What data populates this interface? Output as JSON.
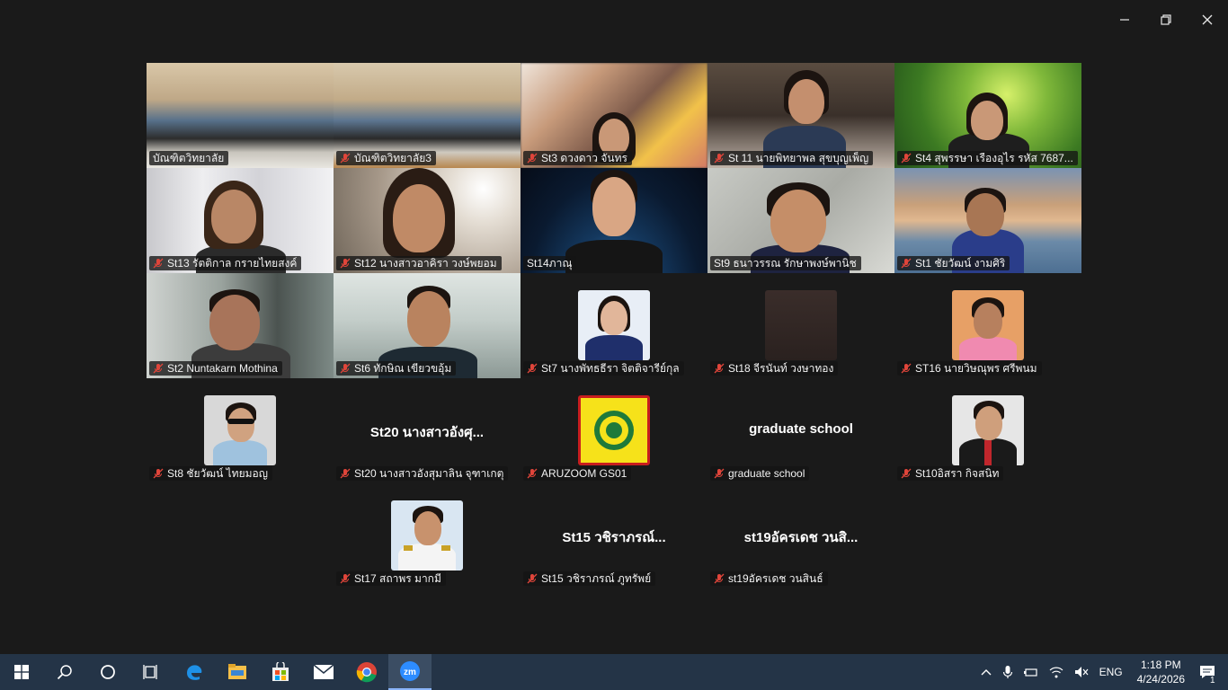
{
  "window": {
    "minimize_icon": "minimize-icon",
    "restore_icon": "restore-icon",
    "close_icon": "close-icon"
  },
  "participants": [
    {
      "name": "บัณฑิตวิทยาลัย",
      "muted": false,
      "type": "video"
    },
    {
      "name": "บัณฑิตวิทยาลัย3",
      "muted": true,
      "type": "video"
    },
    {
      "name": "St3 ดวงดาว จันทร",
      "muted": true,
      "type": "video"
    },
    {
      "name": "St 11 นายพิทยาพล สุขบุญเพ็ญ",
      "muted": true,
      "type": "video"
    },
    {
      "name": "St4 สุพรรษา เรืองอุไร รหัส 7687...",
      "muted": true,
      "type": "video"
    },
    {
      "name": "St13 รัตติกาล กรายไทยสงค์",
      "muted": true,
      "type": "video"
    },
    {
      "name": "St12 นางสาวอาคิรา วงษ์พยอม",
      "muted": true,
      "type": "video"
    },
    {
      "name": "St14ภาณุ",
      "muted": false,
      "type": "video"
    },
    {
      "name": "St9 ธนาวรรณ รักษาพงษ์พานิช",
      "muted": false,
      "type": "video",
      "active": true
    },
    {
      "name": "St1 ชัยวัฒน์ งามศิริ",
      "muted": true,
      "type": "video"
    },
    {
      "name": "St2 Nuntakarn Mothina",
      "muted": true,
      "type": "video"
    },
    {
      "name": "St6 ทักษิณ เขียวขอุ้ม",
      "muted": true,
      "type": "video"
    },
    {
      "name": "St7 นางพัทธธีรา จิตติจารีย์กุล",
      "muted": true,
      "type": "avatar"
    },
    {
      "name": "St18 จีรนันท์ วงษาทอง",
      "muted": true,
      "type": "avatar"
    },
    {
      "name": "ST16 นายวิษณุพร ศรีพนม",
      "muted": true,
      "type": "avatar"
    },
    {
      "name": "St8 ชัยวัฒน์ ไทยมอญ",
      "muted": true,
      "type": "avatar"
    },
    {
      "name": "St20 นางสาวอังสุมาลิน จุฑาเกตุ",
      "muted": true,
      "type": "text",
      "display": "St20 นางสาวอังศุ..."
    },
    {
      "name": "ARUZOOM GS01",
      "muted": true,
      "type": "avatar"
    },
    {
      "name": "graduate school",
      "muted": true,
      "type": "text",
      "display": "graduate school"
    },
    {
      "name": "St10อิสรา กิจสนิท",
      "muted": true,
      "type": "avatar"
    },
    {
      "name": "St17 สถาพร มากมี",
      "muted": true,
      "type": "avatar"
    },
    {
      "name": "St15 วชิราภรณ์ ภูทรัพย์",
      "muted": true,
      "type": "text",
      "display": "St15 วชิราภรณ์..."
    },
    {
      "name": "st19อัครเดช วนสินธ์",
      "muted": true,
      "type": "text",
      "display": "st19อัครเดช วนสิ..."
    }
  ],
  "taskbar": {
    "apps": [
      "start-icon",
      "search-icon",
      "cortana-icon",
      "task-view-icon",
      "edge-icon",
      "file-explorer-icon",
      "store-icon",
      "mail-icon",
      "chrome-icon",
      "zoom-icon"
    ],
    "language": "ENG",
    "time": "1:18 PM",
    "date": "4/24/2026",
    "notification_count": "1"
  },
  "colors": {
    "active_speaker": "#23d96e",
    "taskbar": "#243447",
    "mute": "#e0453a"
  }
}
